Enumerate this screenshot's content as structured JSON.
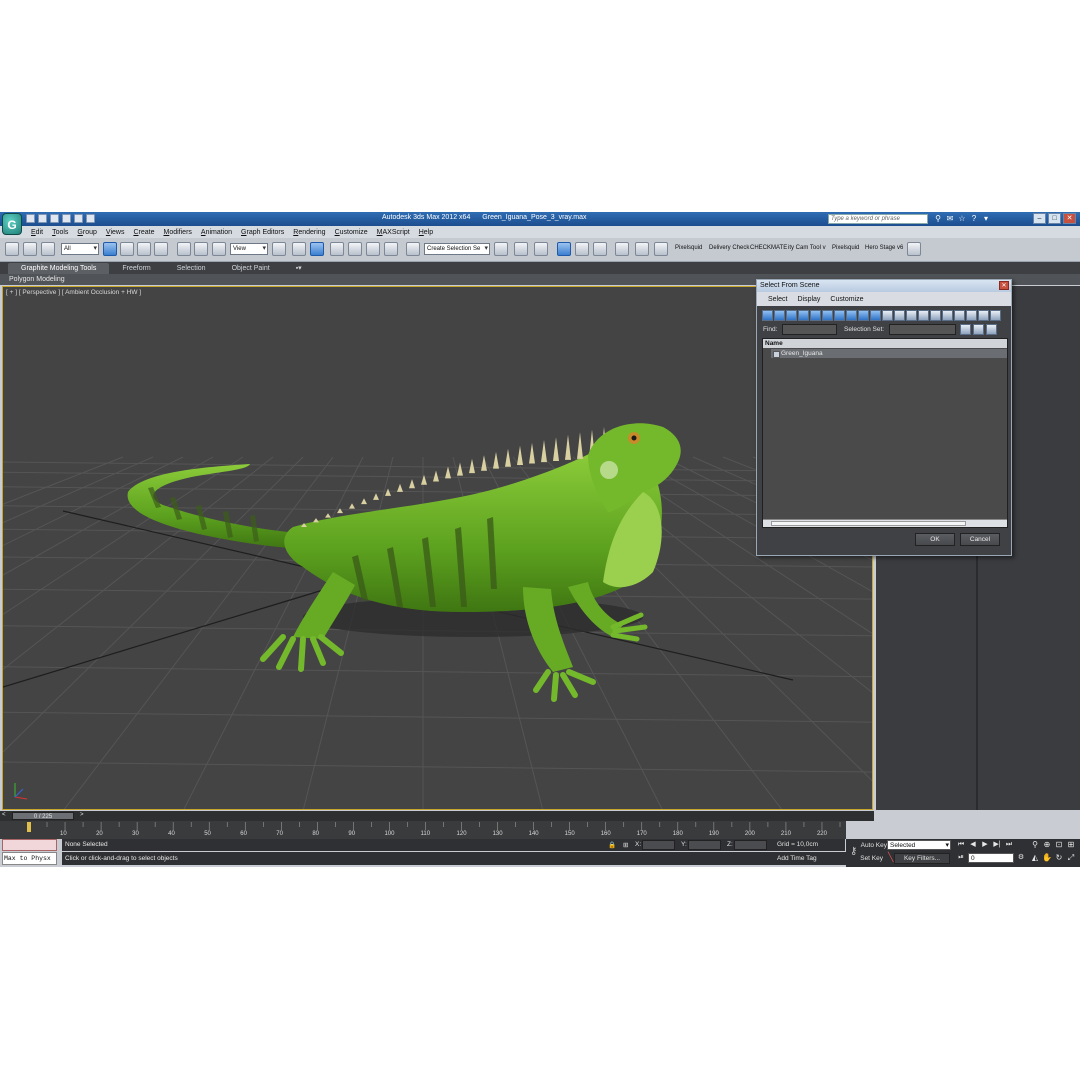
{
  "titlebar": {
    "app_title": "Autodesk 3ds Max  2012 x64",
    "file_name": "Green_Iguana_Pose_3_vray.max",
    "search_placeholder": "Type a keyword or phrase",
    "logo": "3ds-max-logo"
  },
  "menubar": {
    "items": [
      "Edit",
      "Tools",
      "Group",
      "Views",
      "Create",
      "Modifiers",
      "Animation",
      "Graph Editors",
      "Rendering",
      "Customize",
      "MAXScript",
      "Help"
    ]
  },
  "toolbar": {
    "selection_filter": "All",
    "ref_coord": "View",
    "named_selection": "Create Selection Se",
    "plugin_labels": [
      "Pixelsquid",
      "Delivery Check",
      "CHECKMATE",
      "ity Cam Tool v",
      "Pixelsquid",
      "Hero Stage v6"
    ]
  },
  "ribbon": {
    "tabs": [
      "Graphite Modeling Tools",
      "Freeform",
      "Selection",
      "Object Paint"
    ],
    "active_tab": "Graphite Modeling Tools",
    "sub_label": "Polygon Modeling"
  },
  "viewport": {
    "label": "[ + ] [ Perspective ] [ Ambient Occlusion + HW ]",
    "object": "green-iguana-3d-model"
  },
  "dialog": {
    "title": "Select From Scene",
    "menu": [
      "Select",
      "Display",
      "Customize"
    ],
    "find_label": "Find:",
    "selection_set_label": "Selection Set:",
    "column_name": "Name",
    "rows": [
      "Green_Iguana"
    ],
    "ok_label": "OK",
    "cancel_label": "Cancel"
  },
  "timeline": {
    "frame_label": "0 / 225",
    "ticks": [
      "10",
      "20",
      "30",
      "40",
      "50",
      "60",
      "70",
      "80",
      "90",
      "100",
      "110",
      "120",
      "130",
      "140",
      "150",
      "160",
      "170",
      "180",
      "190",
      "200",
      "210",
      "220"
    ]
  },
  "status": {
    "max_physx": "Max to Physx",
    "selection_status": "None Selected",
    "prompt": "Click or click-and-drag to select objects",
    "x_label": "X:",
    "y_label": "Y:",
    "z_label": "Z:",
    "grid": "Grid = 10,0cm",
    "add_time_tag": "Add Time Tag",
    "auto_key": "Auto Key",
    "set_key": "Set Key",
    "key_mode": "Selected",
    "key_filters": "Key Filters...",
    "current_frame": "0"
  },
  "colors": {
    "titlebar": "#1c4d8f",
    "viewport_bg": "#444444",
    "iguana_green": "#6fb52a",
    "active_border": "#c7a62a"
  }
}
